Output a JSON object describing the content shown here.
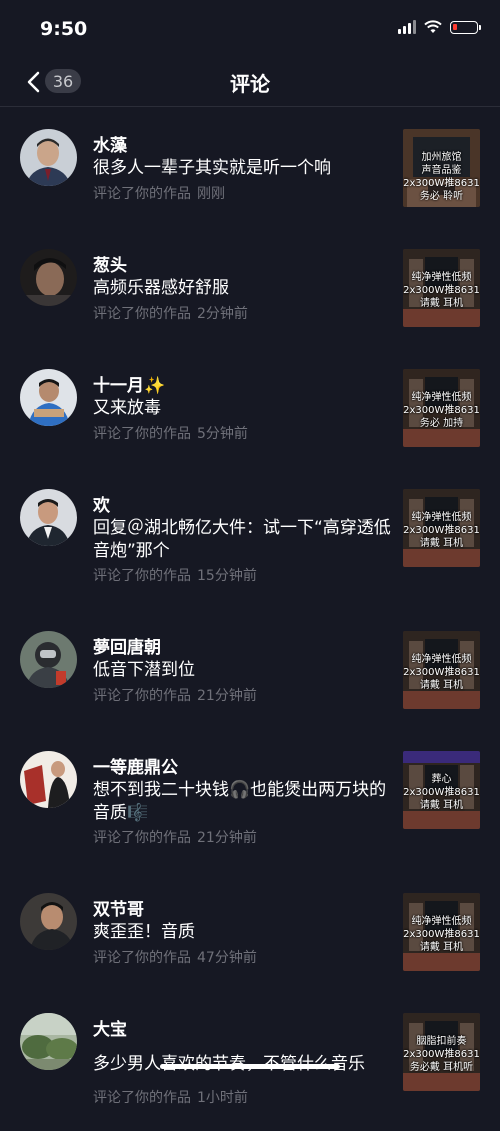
{
  "status": {
    "time": "9:50"
  },
  "nav": {
    "title": "评论",
    "badge": "36"
  },
  "comments": [
    {
      "username": "水藻",
      "text": "很多人一辈子其实就是听一个响",
      "action": "评论了你的作品",
      "time": "刚刚",
      "thumb_text": "加州旅馆\n声音品鉴\n2x300W推8631\n务必    聆听"
    },
    {
      "username": "葱头",
      "text": "高频乐器感好舒服",
      "action": "评论了你的作品",
      "time": "2分钟前",
      "thumb_text": "纯净弹性低频\n2x300W推8631\n请戴    耳机"
    },
    {
      "username": "十一月✨",
      "text": "又来放毒",
      "action": "评论了你的作品",
      "time": "5分钟前",
      "thumb_text": "纯净弹性低频\n2x300W推8631\n务必    加持"
    },
    {
      "username": "欢",
      "text": "回复＠湖北畅亿大件：试一下“高穿透低音炮”那个",
      "action": "评论了你的作品",
      "time": "15分钟前",
      "thumb_text": "纯净弹性低频\n2x300W推8631\n请戴    耳机"
    },
    {
      "username": "夢回唐朝",
      "text": "低音下潜到位",
      "action": "评论了你的作品",
      "time": "21分钟前",
      "thumb_text": "纯净弹性低频\n2x300W推8631\n请戴    耳机"
    },
    {
      "username": "一等鹿鼎公",
      "text": "想不到我二十块钱🎧也能煲出两万块的音质🎼",
      "action": "评论了你的作品",
      "time": "21分钟前",
      "thumb_text": "葬心\n2x300W推8631\n请戴    耳机"
    },
    {
      "username": "双节哥",
      "text": "爽歪歪！音质",
      "action": "评论了你的作品",
      "time": "47分钟前",
      "thumb_text": "纯净弹性低频\n2x300W推8631\n请戴    耳机"
    },
    {
      "username": "大宝",
      "text": "多少男人喜欢的节奏，不管什么音乐",
      "action": "评论了你的作品",
      "time": "1小时前",
      "thumb_text": "胭脂扣前奏\n2x300W推8631\n务必戴    耳机听"
    }
  ],
  "colors": {
    "background": "#161823",
    "meta": "#6f7079",
    "battery_low": "#ff3b30"
  }
}
